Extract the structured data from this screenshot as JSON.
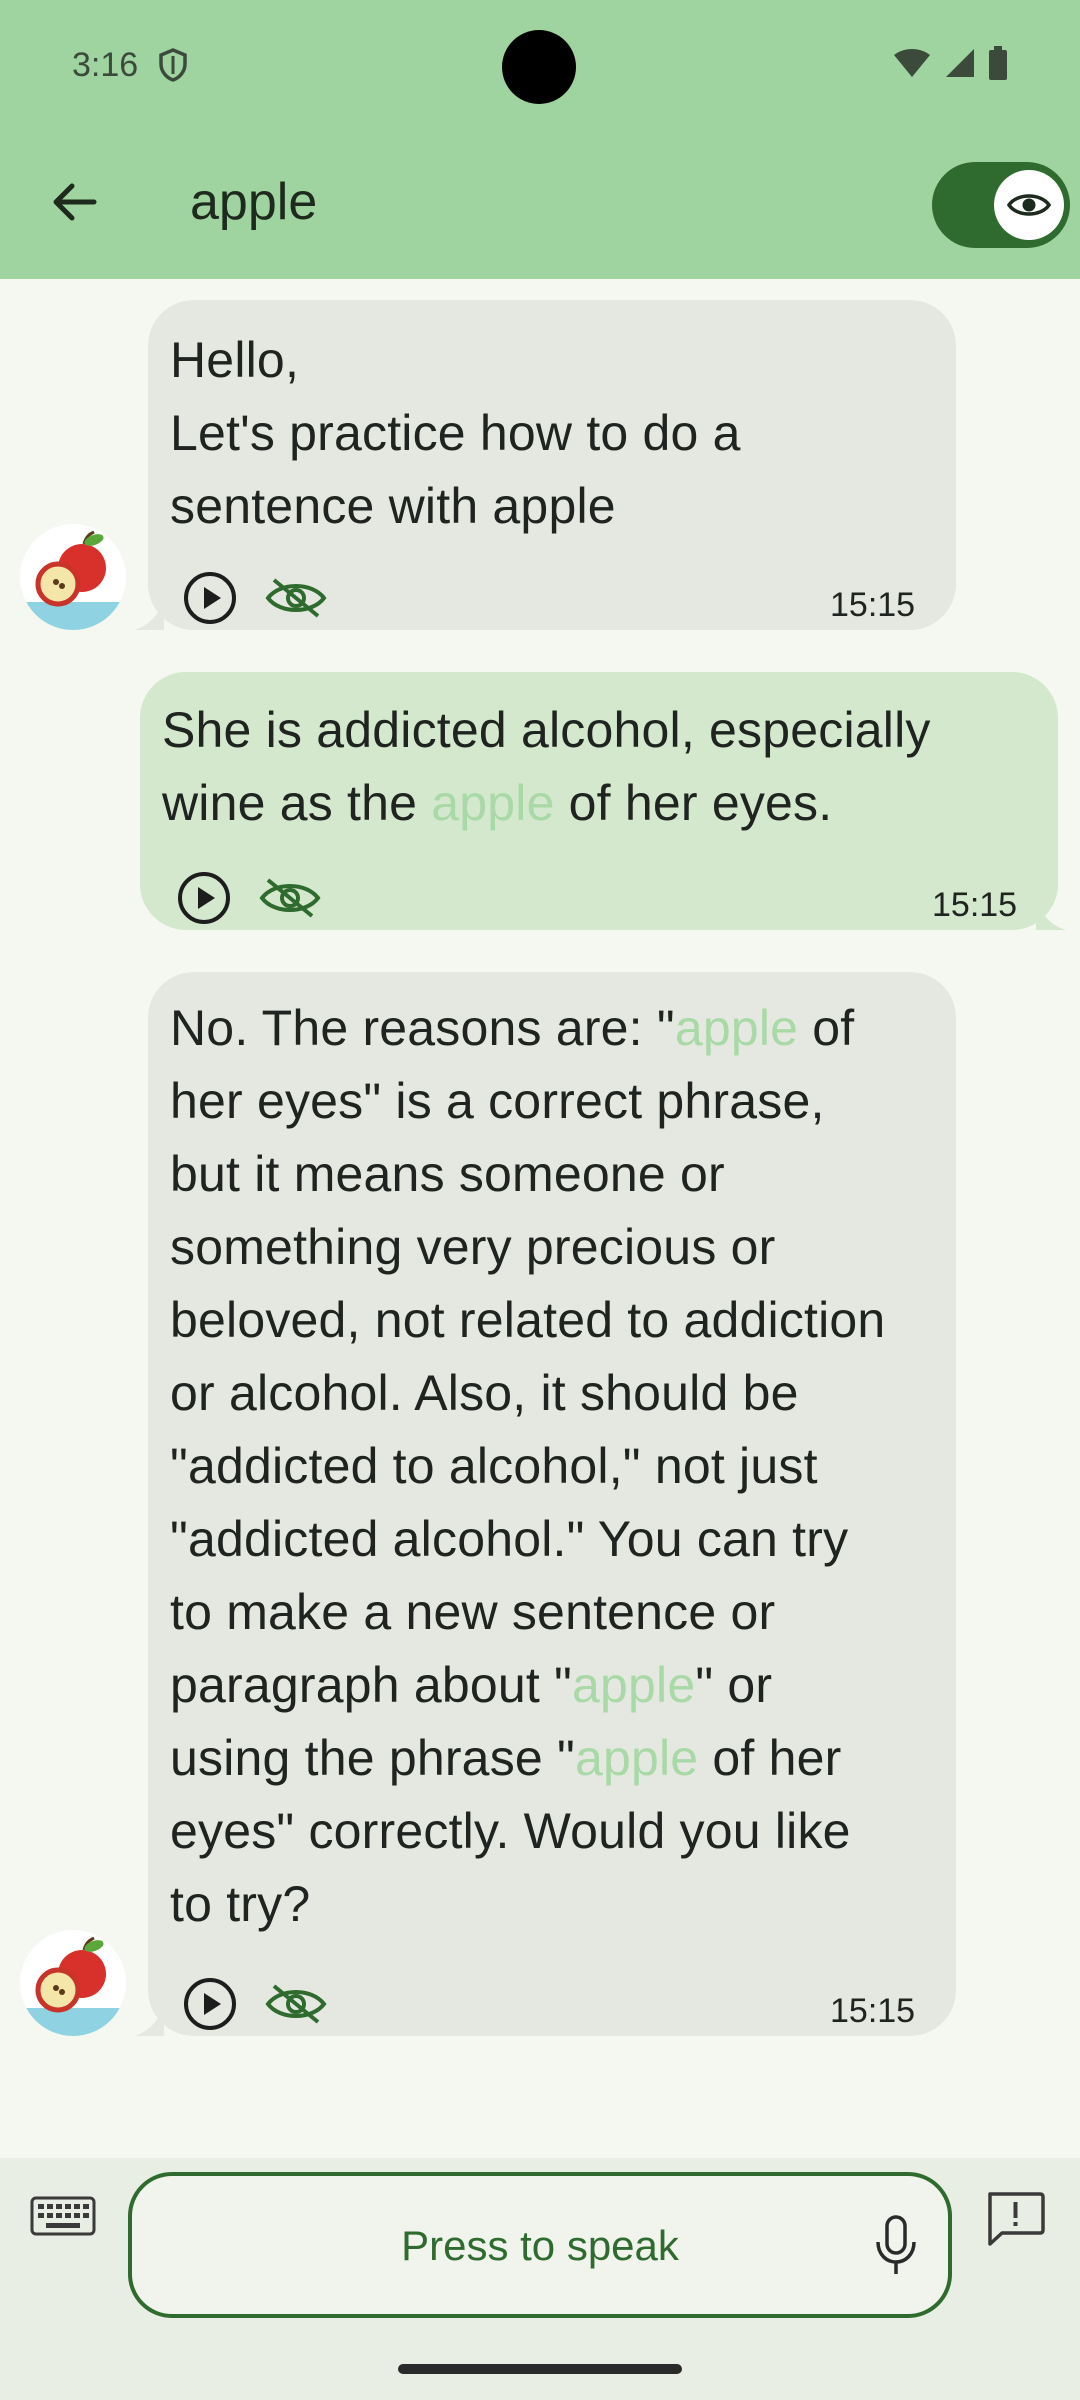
{
  "status_bar": {
    "time": "3:16"
  },
  "header": {
    "title": "apple"
  },
  "messages": [
    {
      "role": "bot",
      "lines": [
        "Hello,",
        "Let's practice how to do a",
        "sentence with apple"
      ],
      "time": "15:15"
    },
    {
      "role": "user",
      "line1": "She is addicted alcohol, especially",
      "line2_before": "wine as the ",
      "line2_hl": "apple",
      "line2_after": " of her eyes.",
      "time": "15:15"
    },
    {
      "role": "bot",
      "l1_before": "No. The reasons are: \"",
      "l1_hl": "apple",
      "l1_after": " of",
      "lines_mid": [
        "her eyes\" is a correct phrase,",
        "but it means someone or",
        "something very precious or",
        "beloved, not related to addiction",
        "or alcohol. Also, it should be",
        "\"addicted to alcohol,\" not just",
        "\"addicted alcohol.\" You can try",
        "to make a new sentence or"
      ],
      "l10_before": "paragraph about \"",
      "l10_hl": "apple",
      "l10_after": "\" or",
      "l11_before": "using the phrase \"",
      "l11_hl": "apple",
      "l11_after": " of her",
      "lines_end": [
        "eyes\" correctly. Would you like",
        "to try?"
      ],
      "time": "15:15"
    }
  ],
  "input": {
    "placeholder": "Press to speak"
  },
  "colors": {
    "header": "#9fd39f",
    "accent": "#2f6b2f",
    "bot_bubble": "#e5e8e0",
    "user_bubble": "#d3e8cc",
    "highlight": "#a9d9a6"
  }
}
